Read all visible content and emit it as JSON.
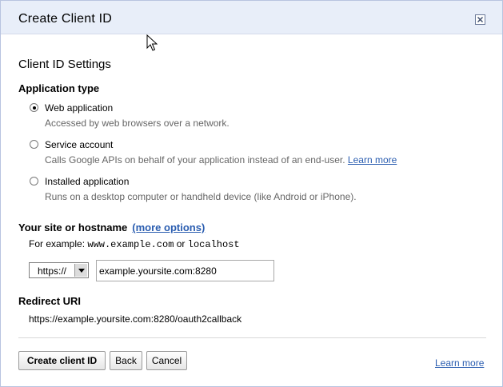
{
  "dialog": {
    "title": "Create Client ID"
  },
  "settings": {
    "heading": "Client ID Settings",
    "application_type_heading": "Application type",
    "options": [
      {
        "label": "Web application",
        "description": "Accessed by web browsers over a network.",
        "checked": true
      },
      {
        "label": "Service account",
        "description": "Calls Google APIs on behalf of your application instead of an end-user.",
        "link": "Learn more",
        "checked": false
      },
      {
        "label": "Installed application",
        "description": "Runs on a desktop computer or handheld device (like Android or iPhone).",
        "checked": false
      }
    ]
  },
  "site": {
    "heading": "Your site or hostname",
    "more_options": "(more options)",
    "example_prefix": "For example:",
    "example_host": "www.example.com",
    "example_or": "or",
    "example_local": "localhost",
    "scheme": "https://",
    "host_value": "example.yoursite.com:8280"
  },
  "redirect": {
    "heading": "Redirect URI",
    "value": "https://example.yoursite.com:8280/oauth2callback"
  },
  "footer": {
    "create_label": "Create client ID",
    "back_label": "Back",
    "cancel_label": "Cancel",
    "learn_more": "Learn more"
  },
  "icons": {
    "close": "close-icon",
    "cursor": "mouse-pointer-icon"
  }
}
